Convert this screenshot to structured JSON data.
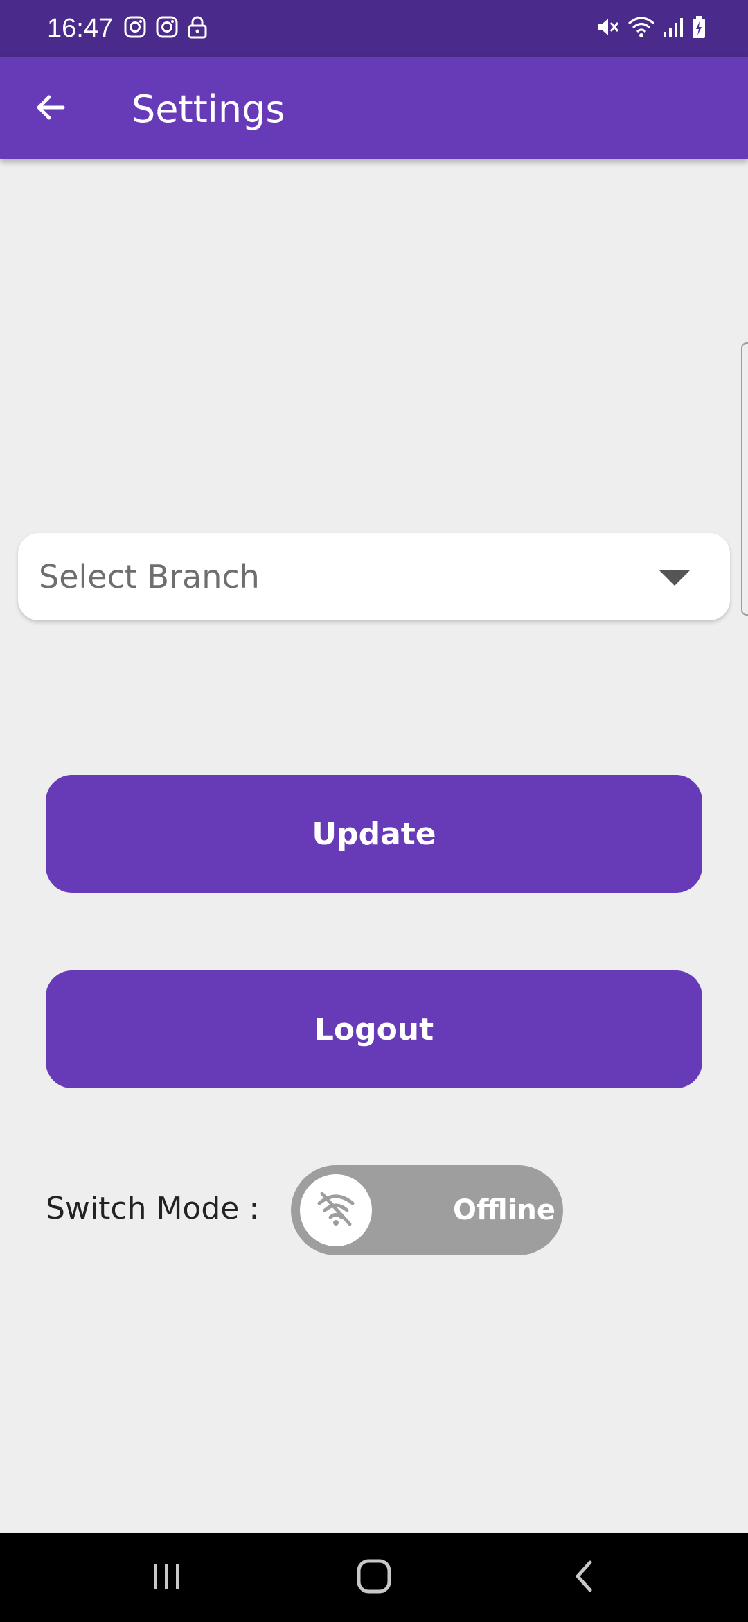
{
  "status_bar": {
    "time": "16:47",
    "icons": [
      "instagram-icon",
      "instagram-icon",
      "lock-icon",
      "mute-icon",
      "wifi-icon",
      "signal-icon",
      "battery-icon"
    ]
  },
  "app_bar": {
    "title": "Settings",
    "back_icon": "arrow-back-icon"
  },
  "branch_select": {
    "placeholder": "Select Branch"
  },
  "buttons": {
    "update_label": "Update",
    "logout_label": "Logout"
  },
  "mode": {
    "label": "Switch Mode :",
    "toggle_state": "Offline",
    "toggle_icon": "wifi-off-icon"
  },
  "nav_bar": {
    "items": [
      "recents-icon",
      "home-icon",
      "back-icon"
    ]
  },
  "colors": {
    "primary": "#673ab7",
    "status_bar": "#4a2a8a",
    "background": "#eeeeee",
    "toggle_off": "#9e9e9e"
  }
}
